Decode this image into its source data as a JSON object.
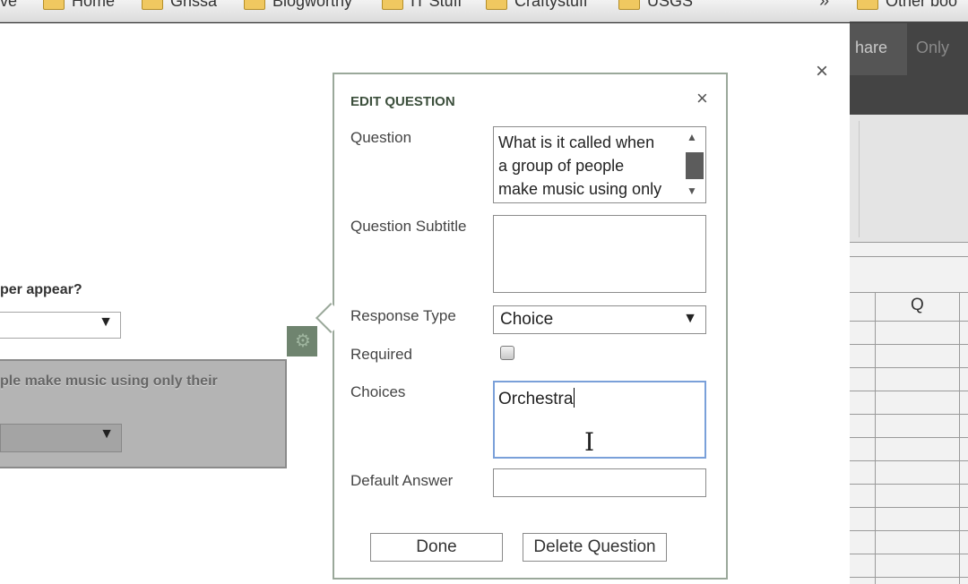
{
  "bookmarks": {
    "items": [
      {
        "label": "ive",
        "folder": false
      },
      {
        "label": "Home",
        "folder": true
      },
      {
        "label": "Grissa",
        "folder": true
      },
      {
        "label": "Blogworthy",
        "folder": true
      },
      {
        "label": "IT Stuff",
        "folder": true
      },
      {
        "label": "Craftystuff",
        "folder": true
      },
      {
        "label": "USGS",
        "folder": true
      }
    ],
    "overflow": "»",
    "other_bookmarks": "Other boo"
  },
  "sheet": {
    "tabs": [
      "hare",
      "Only"
    ],
    "column_header": "Q"
  },
  "main": {
    "close_icon": "×",
    "preview": {
      "q1_text": "per appear?",
      "q2_text": "ple make music using only their",
      "select_arrow": "▼"
    }
  },
  "dialog": {
    "title": "EDIT QUESTION",
    "close_icon": "×",
    "labels": {
      "question": "Question",
      "subtitle": "Question Subtitle",
      "response_type": "Response Type",
      "required": "Required",
      "choices": "Choices",
      "default_answer": "Default Answer"
    },
    "question_value": "What is it called when\na group of people\nmake music using only",
    "subtitle_value": "",
    "response_type_value": "Choice",
    "required_checked": false,
    "choices_value": "Orchestra",
    "default_answer_value": "",
    "done_button": "Done",
    "delete_button": "Delete Question"
  },
  "colors": {
    "dialog_border": "#9aa89a",
    "dialog_title": "#3c4f3c",
    "choices_focus": "#7aa0d9",
    "gear_button": "#6f846f"
  },
  "icons": {
    "gear": "gear-icon",
    "close": "close-icon",
    "dropdown": "chevron-down-icon",
    "folder": "folder-icon",
    "text_cursor": "text-cursor-icon"
  }
}
